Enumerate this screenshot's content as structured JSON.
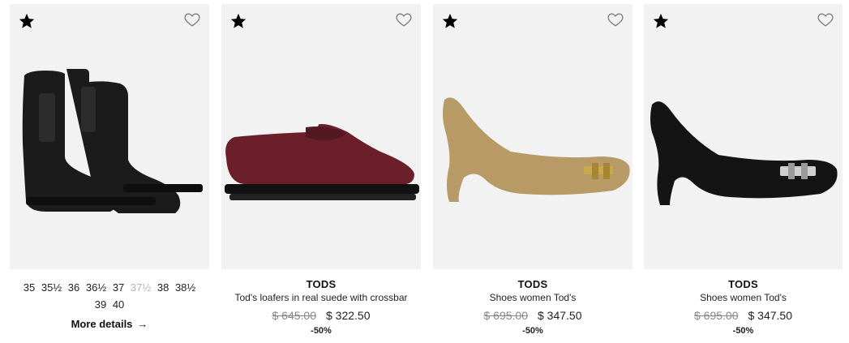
{
  "products": [
    {
      "sizes": [
        {
          "label": "35",
          "available": true
        },
        {
          "label": "35½",
          "available": true
        },
        {
          "label": "36",
          "available": true
        },
        {
          "label": "36½",
          "available": true
        },
        {
          "label": "37",
          "available": true
        },
        {
          "label": "37½",
          "available": false
        },
        {
          "label": "38",
          "available": true
        },
        {
          "label": "38½",
          "available": true
        },
        {
          "label": "39",
          "available": true
        },
        {
          "label": "40",
          "available": true
        }
      ],
      "more_details_label": "More details",
      "arrow": "→",
      "image_icon": "black-suede-ankle-boots",
      "shoe_color": "#1a1a1a"
    },
    {
      "brand": "TODS",
      "description": "Tod's loafers in real suede with crossbar",
      "old_price": "$ 645.00",
      "new_price": "$ 322.50",
      "discount": "-50%",
      "image_icon": "burgundy-suede-loafer",
      "shoe_color": "#6b1f2a"
    },
    {
      "brand": "TODS",
      "description": "Shoes women Tod's",
      "old_price": "$ 695.00",
      "new_price": "$ 347.50",
      "discount": "-50%",
      "image_icon": "beige-suede-pump",
      "shoe_color": "#b89a66"
    },
    {
      "brand": "TODS",
      "description": "Shoes women Tod's",
      "old_price": "$ 695.00",
      "new_price": "$ 347.50",
      "discount": "-50%",
      "image_icon": "black-suede-pump",
      "shoe_color": "#141414"
    }
  ]
}
